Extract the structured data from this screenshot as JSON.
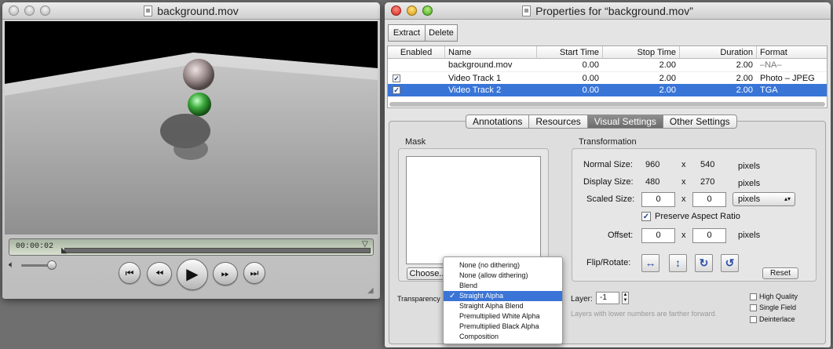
{
  "player": {
    "title": "background.mov",
    "timecode": "00:00:02"
  },
  "properties": {
    "title": "Properties for “background.mov”",
    "toolbar": {
      "extract_label": "Extract",
      "delete_label": "Delete"
    },
    "table": {
      "headers": [
        "Enabled",
        "Name",
        "Start Time",
        "Stop Time",
        "Duration",
        "Format"
      ],
      "rows": [
        {
          "enabled": "",
          "name": "background.mov",
          "start": "0.00",
          "stop": "2.00",
          "duration": "2.00",
          "format": "–NA–"
        },
        {
          "enabled": "✓",
          "name": "Video Track 1",
          "start": "0.00",
          "stop": "2.00",
          "duration": "2.00",
          "format": "Photo – JPEG"
        },
        {
          "enabled": "✓",
          "name": "Video Track 2",
          "start": "0.00",
          "stop": "2.00",
          "duration": "2.00",
          "format": "TGA"
        }
      ]
    },
    "tabs": [
      "Annotations",
      "Resources",
      "Visual Settings",
      "Other Settings"
    ],
    "mask": {
      "label": "Mask",
      "choose_label": "Choose..."
    },
    "transformation": {
      "label": "Transformation",
      "normal_size_label": "Normal Size:",
      "normal_w": "960",
      "normal_h": "540",
      "display_size_label": "Display Size:",
      "display_w": "480",
      "display_h": "270",
      "scaled_size_label": "Scaled Size:",
      "scaled_w": "0",
      "scaled_h": "0",
      "unit_select": "pixels",
      "preserve_label": "Preserve Aspect Ratio",
      "offset_label": "Offset:",
      "offset_x": "0",
      "offset_y": "0",
      "flip_label": "Flip/Rotate:",
      "x": "x",
      "pixels": "pixels",
      "reset_label": "Reset"
    },
    "transparency_label": "Transparency",
    "layer_label": "Layer:",
    "layer_value": "-1",
    "layer_hint": "Layers with lower numbers are farther forward.",
    "options": [
      "High Quality",
      "Single Field",
      "Deinterlace"
    ],
    "menu": {
      "checkmark": "✓",
      "items": [
        "None (no dithering)",
        "None (allow dithering)",
        "Blend",
        "Straight Alpha",
        "Straight Alpha Blend",
        "Premultiplied White Alpha",
        "Premultiplied Black Alpha",
        "Composition"
      ]
    }
  }
}
